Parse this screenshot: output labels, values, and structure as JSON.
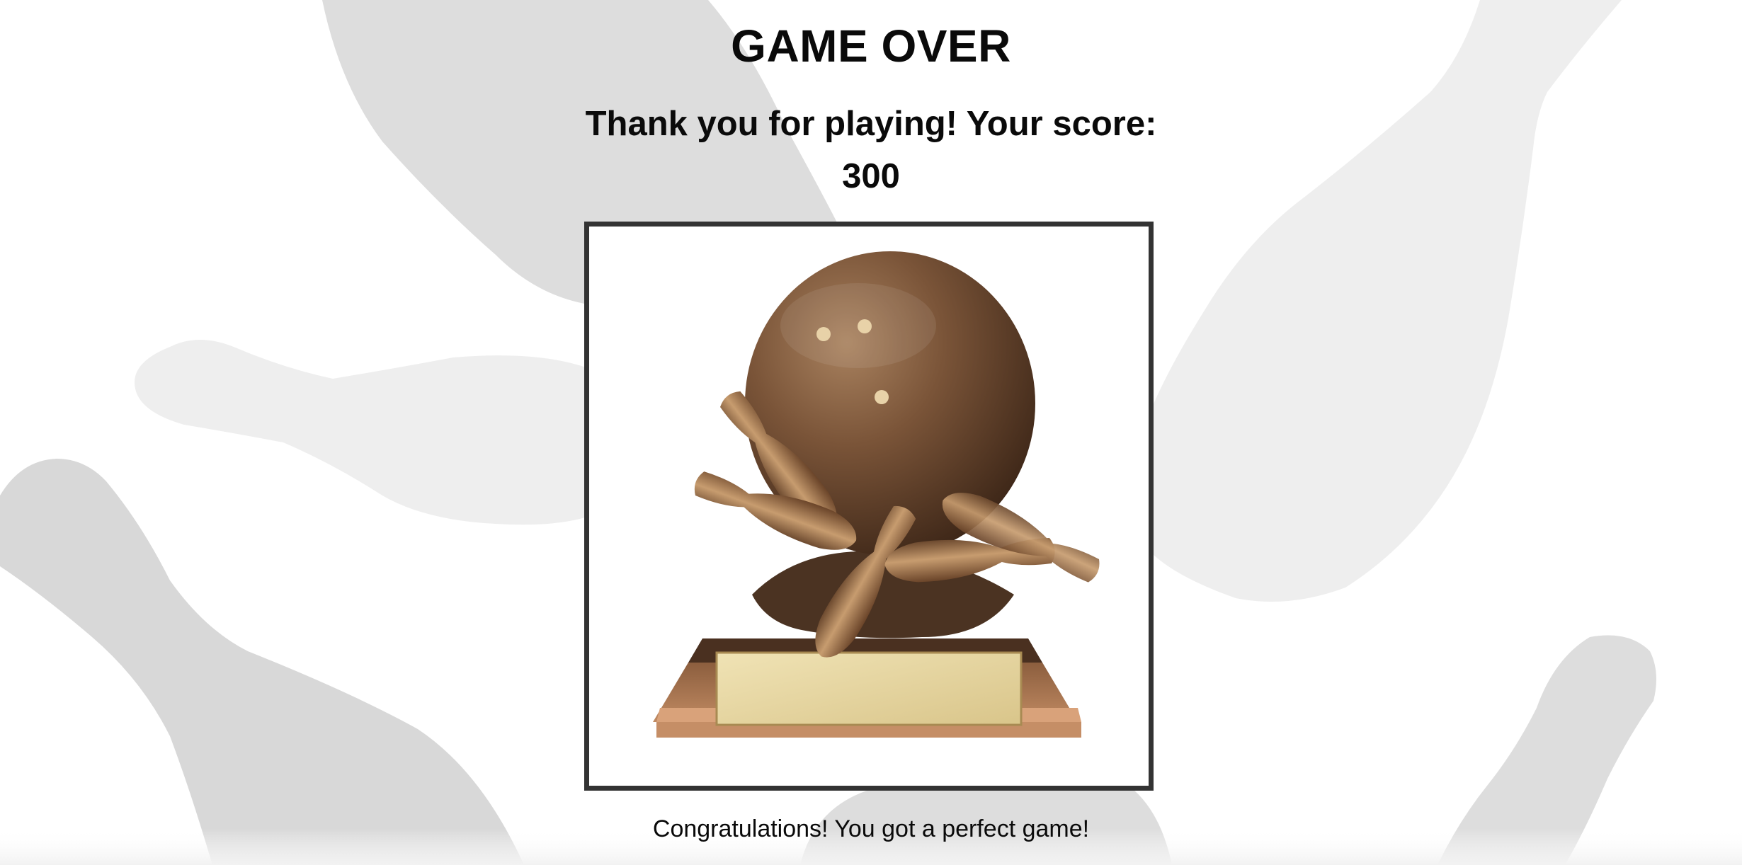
{
  "screen": {
    "title": "GAME OVER",
    "message": "Thank you for playing! Your score:",
    "score": "300",
    "congrats": "Congratulations! You got a perfect game!"
  },
  "trophy": {
    "icon": "bowling-trophy-icon"
  },
  "background": {
    "motif": "bowling-pin-silhouettes",
    "colors": [
      "#dddddd",
      "#eeeeee"
    ]
  },
  "colors": {
    "text": "#0a0a0a",
    "frame_border": "#333333",
    "trophy_bronze": "#7a4f32",
    "plaque_gold": "#e8d9a4"
  }
}
